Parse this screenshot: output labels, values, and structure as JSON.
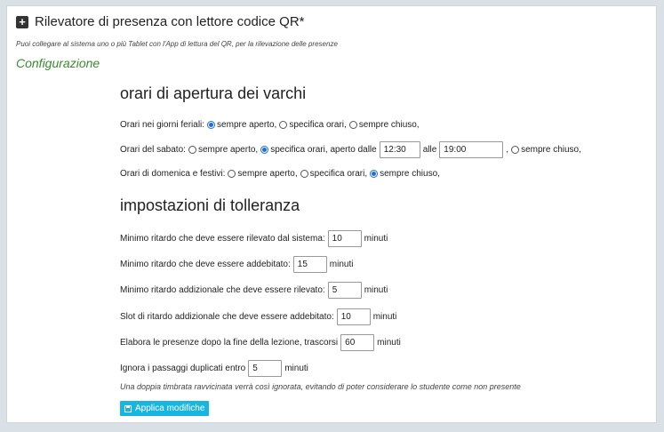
{
  "header": {
    "title": "Rilevatore di presenza con lettore codice QR*",
    "subtitle": "Puoi collegare al sistema uno o più Tablet con l'App di lettura del QR, per la rilevazione delle presenze",
    "section_link": "Configurazione"
  },
  "opening_hours": {
    "heading": "orari di apertura dei varchi",
    "weekdays": {
      "label": "Orari nei giorni feriali:",
      "options": [
        "sempre aperto,",
        "specifica orari,",
        "sempre chiuso,"
      ],
      "selected": "sempre aperto,"
    },
    "saturday": {
      "label": "Orari del sabato:",
      "option_open": "sempre aperto,",
      "option_specific": "specifica orari, aperto dalle",
      "from_value": "12:30",
      "to_label": "alle",
      "to_value": "19:00",
      "comma": ",",
      "option_closed": "sempre chiuso,",
      "selected": "specifica orari, aperto dalle"
    },
    "sundays": {
      "label": "Orari di domenica e festivi:",
      "options": [
        "sempre aperto,",
        "specifica orari,",
        "sempre chiuso,"
      ],
      "selected": "sempre chiuso,"
    }
  },
  "tolerance": {
    "heading": "impostazioni di tolleranza",
    "unit": "minuti",
    "fields": [
      {
        "label": "Minimo ritardo che deve essere rilevato dal sistema:",
        "value": "10"
      },
      {
        "label": "Minimo ritardo che deve essere addebitato:",
        "value": "15"
      },
      {
        "label": "Minimo ritardo addizionale che deve essere rilevato:",
        "value": "5"
      },
      {
        "label": "Slot di ritardo addizionale che deve essere addebitato:",
        "value": "10"
      },
      {
        "label": "Elabora le presenze dopo la fine della lezione, trascorsi",
        "value": "60"
      },
      {
        "label": "Ignora i passaggi duplicati entro",
        "value": "5"
      }
    ],
    "note": "Una doppia timbrata ravvicinata verrà così ignorata, evitando di poter considerare lo studente come non presente"
  },
  "actions": {
    "apply_label": "Applica modifiche"
  },
  "colors": {
    "accent_green": "#3a8a2f",
    "button_blue": "#17b6e0",
    "radio_blue": "#1f6fd1"
  }
}
